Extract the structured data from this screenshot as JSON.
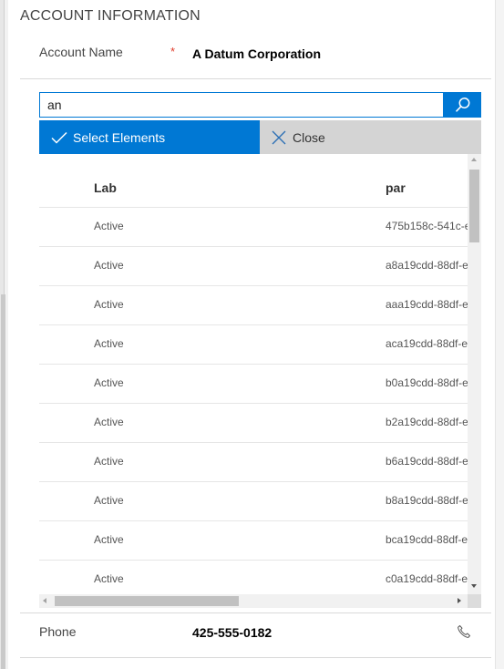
{
  "section": {
    "title": "ACCOUNT INFORMATION"
  },
  "account_name": {
    "label": "Account Name",
    "required_marker": "*",
    "value": "A Datum Corporation"
  },
  "lookup": {
    "search_value": "an",
    "search_icon": "search-icon",
    "select_label": "Select Elements",
    "select_icon": "checkmark-icon",
    "close_label": "Close",
    "close_icon": "close-icon",
    "columns": [
      "Lab",
      "par"
    ],
    "rows": [
      {
        "status": "Active",
        "id": "475b158c-541c-e"
      },
      {
        "status": "Active",
        "id": "a8a19cdd-88df-e"
      },
      {
        "status": "Active",
        "id": "aaa19cdd-88df-e"
      },
      {
        "status": "Active",
        "id": "aca19cdd-88df-e"
      },
      {
        "status": "Active",
        "id": "b0a19cdd-88df-e"
      },
      {
        "status": "Active",
        "id": "b2a19cdd-88df-e"
      },
      {
        "status": "Active",
        "id": "b6a19cdd-88df-e"
      },
      {
        "status": "Active",
        "id": "b8a19cdd-88df-e"
      },
      {
        "status": "Active",
        "id": "bca19cdd-88df-e"
      },
      {
        "status": "Active",
        "id": "c0a19cdd-88df-e"
      }
    ]
  },
  "phone": {
    "label": "Phone",
    "value": "425-555-0182",
    "icon": "phone-icon"
  },
  "colors": {
    "accent": "#0078d4",
    "close_bg": "#d4d4d4",
    "required": "#e03b2a"
  }
}
